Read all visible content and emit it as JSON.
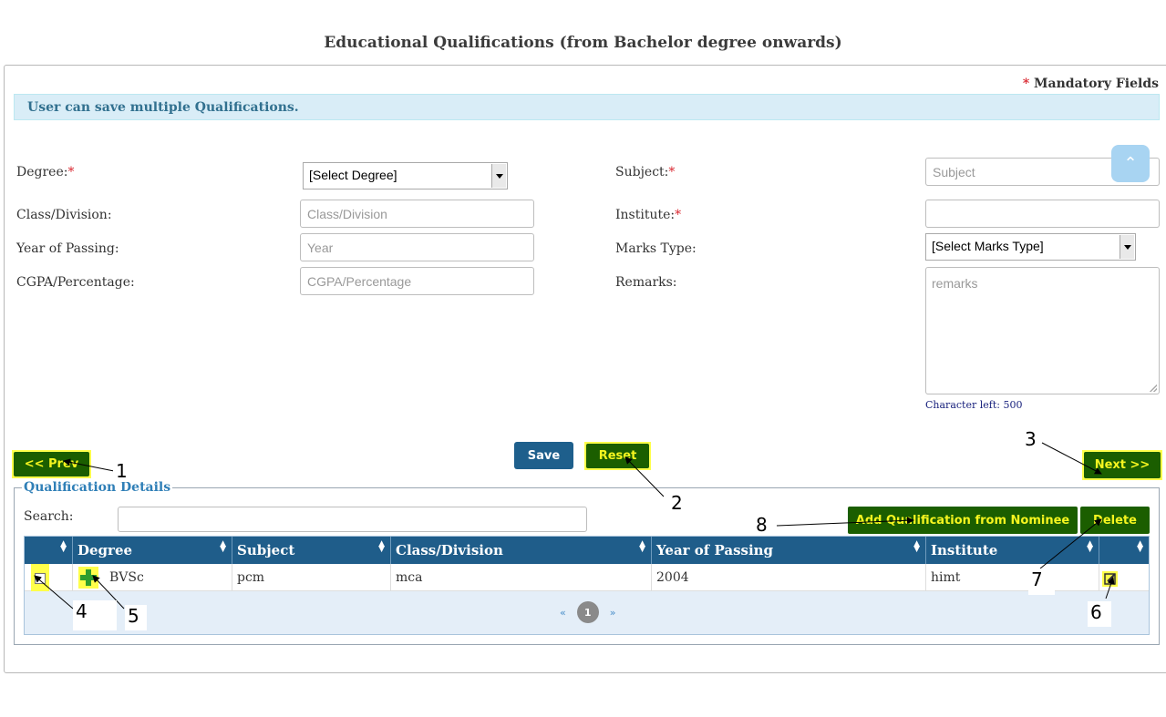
{
  "page": {
    "title": "Educational Qualifications (from Bachelor degree onwards)"
  },
  "form": {
    "mandatory_star": "*",
    "mandatory_text": "Mandatory Fields",
    "info_message": "User can save multiple Qualifications.",
    "degree": {
      "label": "Degree:",
      "selected": "[Select Degree]"
    },
    "subject": {
      "label": "Subject:",
      "placeholder": "Subject"
    },
    "class_division": {
      "label": "Class/Division:",
      "placeholder": "Class/Division"
    },
    "institute": {
      "label": "Institute:",
      "placeholder": ""
    },
    "year_of_passing": {
      "label": "Year of Passing:",
      "placeholder": "Year"
    },
    "marks_type": {
      "label": "Marks Type:",
      "selected": "[Select Marks Type]"
    },
    "cgpa": {
      "label": "CGPA/Percentage:",
      "placeholder": "CGPA/Percentage"
    },
    "remarks": {
      "label": "Remarks:",
      "placeholder": "remarks",
      "char_left": "Character left: 500"
    },
    "required_star": "*"
  },
  "buttons": {
    "prev": "<< Prev",
    "save": "Save",
    "reset": "Reset",
    "next": "Next >>",
    "add_from_nominee": "Add Qualification from Nominee",
    "delete": "Delete"
  },
  "details": {
    "legend": "Qualification Details",
    "search_label": "Search:",
    "columns": [
      "Degree",
      "Subject",
      "Class/Division",
      "Year of Passing",
      "Institute"
    ],
    "rows": [
      {
        "degree": "BVSc",
        "subject": "pcm",
        "class_division": "mca",
        "year": "2004",
        "institute": "himt"
      }
    ],
    "pager": {
      "prev": "«",
      "current": "1",
      "next": "»"
    }
  },
  "annotations": [
    "1",
    "2",
    "3",
    "4",
    "5",
    "6",
    "7",
    "8"
  ],
  "icons": {
    "scroll_top": "chevron-up-icon",
    "sort": "sort-icon",
    "expand": "plus-icon",
    "edit": "edit-icon"
  },
  "colors": {
    "header_bg": "#1f5d8a",
    "green_button": "#1b5e00",
    "green_button_text": "#f5f51f",
    "highlight": "#ffff4a",
    "info_bg": "#d9edf7"
  }
}
